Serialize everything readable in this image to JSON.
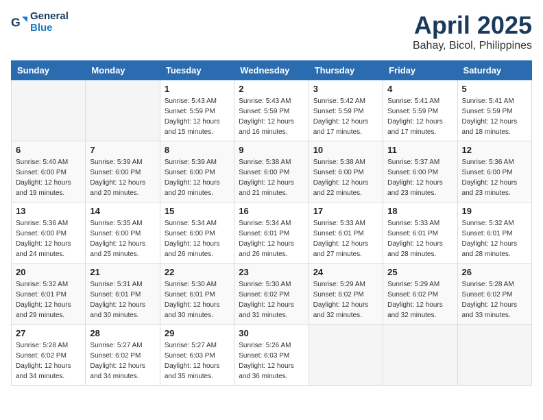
{
  "header": {
    "logo_line1": "General",
    "logo_line2": "Blue",
    "month": "April 2025",
    "location": "Bahay, Bicol, Philippines"
  },
  "days_of_week": [
    "Sunday",
    "Monday",
    "Tuesday",
    "Wednesday",
    "Thursday",
    "Friday",
    "Saturday"
  ],
  "weeks": [
    [
      {
        "day": "",
        "info": ""
      },
      {
        "day": "",
        "info": ""
      },
      {
        "day": "1",
        "info": "Sunrise: 5:43 AM\nSunset: 5:59 PM\nDaylight: 12 hours\nand 15 minutes."
      },
      {
        "day": "2",
        "info": "Sunrise: 5:43 AM\nSunset: 5:59 PM\nDaylight: 12 hours\nand 16 minutes."
      },
      {
        "day": "3",
        "info": "Sunrise: 5:42 AM\nSunset: 5:59 PM\nDaylight: 12 hours\nand 17 minutes."
      },
      {
        "day": "4",
        "info": "Sunrise: 5:41 AM\nSunset: 5:59 PM\nDaylight: 12 hours\nand 17 minutes."
      },
      {
        "day": "5",
        "info": "Sunrise: 5:41 AM\nSunset: 5:59 PM\nDaylight: 12 hours\nand 18 minutes."
      }
    ],
    [
      {
        "day": "6",
        "info": "Sunrise: 5:40 AM\nSunset: 6:00 PM\nDaylight: 12 hours\nand 19 minutes."
      },
      {
        "day": "7",
        "info": "Sunrise: 5:39 AM\nSunset: 6:00 PM\nDaylight: 12 hours\nand 20 minutes."
      },
      {
        "day": "8",
        "info": "Sunrise: 5:39 AM\nSunset: 6:00 PM\nDaylight: 12 hours\nand 20 minutes."
      },
      {
        "day": "9",
        "info": "Sunrise: 5:38 AM\nSunset: 6:00 PM\nDaylight: 12 hours\nand 21 minutes."
      },
      {
        "day": "10",
        "info": "Sunrise: 5:38 AM\nSunset: 6:00 PM\nDaylight: 12 hours\nand 22 minutes."
      },
      {
        "day": "11",
        "info": "Sunrise: 5:37 AM\nSunset: 6:00 PM\nDaylight: 12 hours\nand 23 minutes."
      },
      {
        "day": "12",
        "info": "Sunrise: 5:36 AM\nSunset: 6:00 PM\nDaylight: 12 hours\nand 23 minutes."
      }
    ],
    [
      {
        "day": "13",
        "info": "Sunrise: 5:36 AM\nSunset: 6:00 PM\nDaylight: 12 hours\nand 24 minutes."
      },
      {
        "day": "14",
        "info": "Sunrise: 5:35 AM\nSunset: 6:00 PM\nDaylight: 12 hours\nand 25 minutes."
      },
      {
        "day": "15",
        "info": "Sunrise: 5:34 AM\nSunset: 6:00 PM\nDaylight: 12 hours\nand 26 minutes."
      },
      {
        "day": "16",
        "info": "Sunrise: 5:34 AM\nSunset: 6:01 PM\nDaylight: 12 hours\nand 26 minutes."
      },
      {
        "day": "17",
        "info": "Sunrise: 5:33 AM\nSunset: 6:01 PM\nDaylight: 12 hours\nand 27 minutes."
      },
      {
        "day": "18",
        "info": "Sunrise: 5:33 AM\nSunset: 6:01 PM\nDaylight: 12 hours\nand 28 minutes."
      },
      {
        "day": "19",
        "info": "Sunrise: 5:32 AM\nSunset: 6:01 PM\nDaylight: 12 hours\nand 28 minutes."
      }
    ],
    [
      {
        "day": "20",
        "info": "Sunrise: 5:32 AM\nSunset: 6:01 PM\nDaylight: 12 hours\nand 29 minutes."
      },
      {
        "day": "21",
        "info": "Sunrise: 5:31 AM\nSunset: 6:01 PM\nDaylight: 12 hours\nand 30 minutes."
      },
      {
        "day": "22",
        "info": "Sunrise: 5:30 AM\nSunset: 6:01 PM\nDaylight: 12 hours\nand 30 minutes."
      },
      {
        "day": "23",
        "info": "Sunrise: 5:30 AM\nSunset: 6:02 PM\nDaylight: 12 hours\nand 31 minutes."
      },
      {
        "day": "24",
        "info": "Sunrise: 5:29 AM\nSunset: 6:02 PM\nDaylight: 12 hours\nand 32 minutes."
      },
      {
        "day": "25",
        "info": "Sunrise: 5:29 AM\nSunset: 6:02 PM\nDaylight: 12 hours\nand 32 minutes."
      },
      {
        "day": "26",
        "info": "Sunrise: 5:28 AM\nSunset: 6:02 PM\nDaylight: 12 hours\nand 33 minutes."
      }
    ],
    [
      {
        "day": "27",
        "info": "Sunrise: 5:28 AM\nSunset: 6:02 PM\nDaylight: 12 hours\nand 34 minutes."
      },
      {
        "day": "28",
        "info": "Sunrise: 5:27 AM\nSunset: 6:02 PM\nDaylight: 12 hours\nand 34 minutes."
      },
      {
        "day": "29",
        "info": "Sunrise: 5:27 AM\nSunset: 6:03 PM\nDaylight: 12 hours\nand 35 minutes."
      },
      {
        "day": "30",
        "info": "Sunrise: 5:26 AM\nSunset: 6:03 PM\nDaylight: 12 hours\nand 36 minutes."
      },
      {
        "day": "",
        "info": ""
      },
      {
        "day": "",
        "info": ""
      },
      {
        "day": "",
        "info": ""
      }
    ]
  ]
}
